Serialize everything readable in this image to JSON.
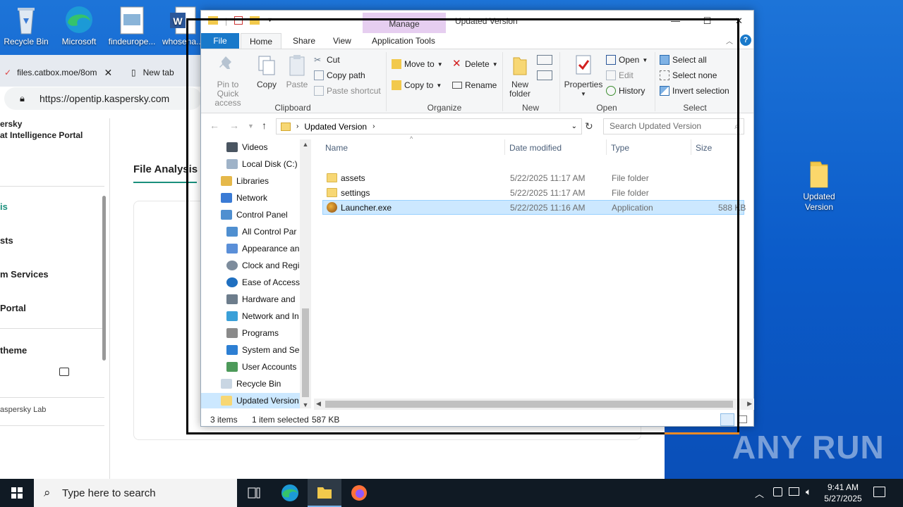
{
  "desktop": {
    "icons": [
      {
        "label": "Recycle Bin"
      },
      {
        "label": "Microsoft"
      },
      {
        "label": "findeurope..."
      },
      {
        "label": "whosena..."
      },
      {
        "label": "Updated Version"
      }
    ]
  },
  "browser": {
    "tabs": [
      {
        "label": "files.catbox.moe/8om"
      },
      {
        "label": "New tab"
      }
    ],
    "url": "https://opentip.kaspersky.com",
    "brand_line1": "ersky",
    "brand_line2": "at Intelligence Portal",
    "page_heading": "File Analysis",
    "side_items": [
      "is",
      "sts",
      "m Services",
      "Portal",
      " theme"
    ],
    "footer": "aspersky Lab"
  },
  "explorer": {
    "manage_label": "Manage",
    "title": "Updated Version",
    "tabs": {
      "file": "File",
      "home": "Home",
      "share": "Share",
      "view": "View",
      "app_tools": "Application Tools"
    },
    "ribbon": {
      "pin_label": "Pin to Quick access",
      "copy": "Copy",
      "paste": "Paste",
      "cut": "Cut",
      "copy_path": "Copy path",
      "paste_shortcut": "Paste shortcut",
      "clipboard_group": "Clipboard",
      "move_to": "Move to",
      "copy_to": "Copy to",
      "delete": "Delete",
      "rename": "Rename",
      "organize_group": "Organize",
      "new_folder": "New folder",
      "new_group": "New",
      "properties": "Properties",
      "open": "Open",
      "edit": "Edit",
      "history": "History",
      "open_group": "Open",
      "select_all": "Select all",
      "select_none": "Select none",
      "invert_selection": "Invert selection",
      "select_group": "Select"
    },
    "path_segment": "Updated Version",
    "search_placeholder": "Search Updated Version",
    "nav_items": [
      "Videos",
      "Local Disk (C:)",
      "Libraries",
      "Network",
      "Control Panel",
      "All Control Par",
      "Appearance an",
      "Clock and Regi",
      "Ease of Access",
      "Hardware and",
      "Network and In",
      "Programs",
      "System and Sec",
      "User Accounts",
      "Recycle Bin",
      "Updated Version"
    ],
    "columns": {
      "name": "Name",
      "date": "Date modified",
      "type": "Type",
      "size": "Size"
    },
    "files": [
      {
        "name": "assets",
        "date": "5/22/2025 11:17 AM",
        "type": "File folder",
        "size": ""
      },
      {
        "name": "settings",
        "date": "5/22/2025 11:17 AM",
        "type": "File folder",
        "size": ""
      },
      {
        "name": "Launcher.exe",
        "date": "5/22/2025 11:16 AM",
        "type": "Application",
        "size": "588 KB"
      }
    ],
    "status": {
      "count": "3 items",
      "selected": "1 item selected",
      "size": "587 KB"
    }
  },
  "watermark": "ANY RUN",
  "taskbar": {
    "search_placeholder": "Type here to search",
    "time": "9:41 AM",
    "date": "5/27/2025"
  },
  "colors": {
    "accent": "#1979ca",
    "manage_tab": "#e6cef0",
    "selection": "#cce8ff",
    "taskbar": "#101a24"
  }
}
